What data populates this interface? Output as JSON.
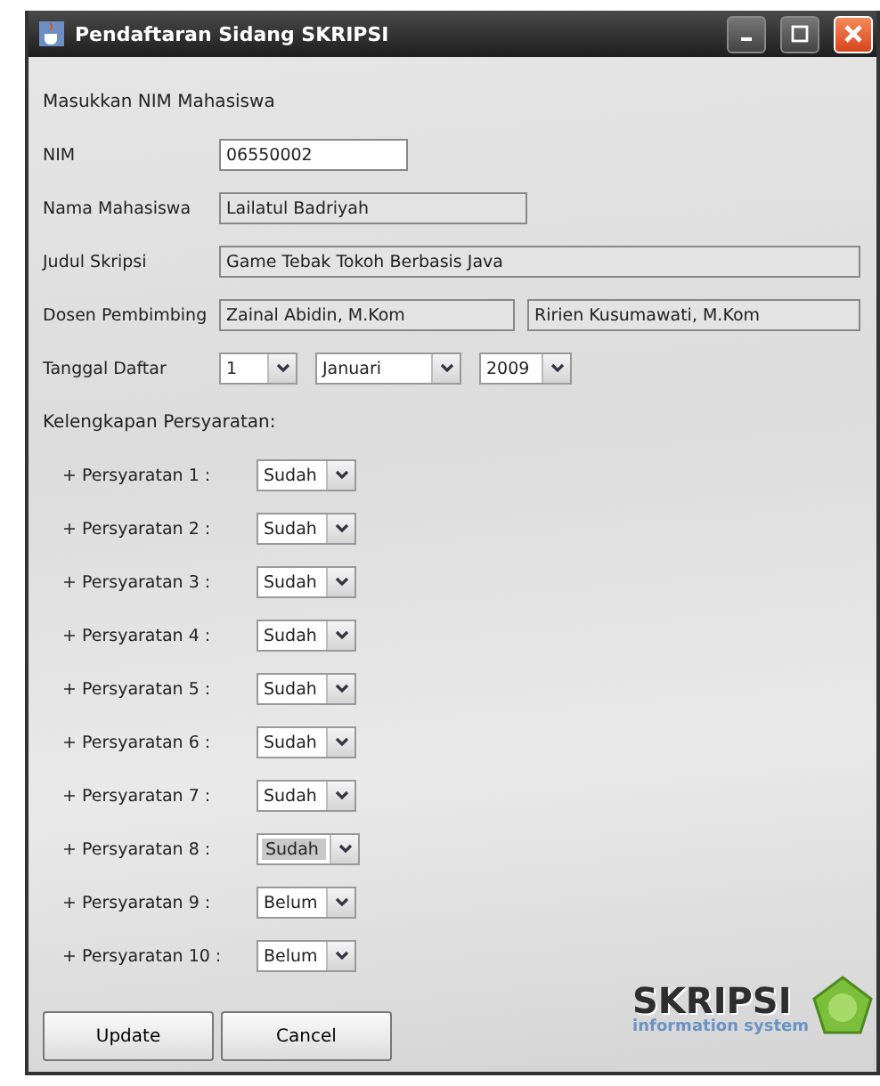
{
  "window": {
    "title": "Pendaftaran Sidang SKRIPSI"
  },
  "heading": "Masukkan NIM Mahasiswa",
  "fields": [
    {
      "label": "NIM",
      "value": "06550002",
      "editable": true
    },
    {
      "label": "Nama Mahasiswa",
      "value": "Lailatul Badriyah",
      "editable": false
    },
    {
      "label": "Judul Skripsi",
      "value": "Game Tebak Tokoh Berbasis Java",
      "editable": false
    }
  ],
  "supervisors": {
    "label": "Dosen Pembimbing",
    "values": [
      "Zainal Abidin, M.Kom",
      "Ririen Kusumawati, M.Kom"
    ]
  },
  "date": {
    "label": "Tanggal Daftar",
    "day": "1",
    "month": "Januari",
    "year": "2009"
  },
  "requirements_heading": "Kelengkapan Persyaratan:",
  "requirements": [
    {
      "label": "+ Persyaratan 1 :",
      "value": "Sudah",
      "focused": false
    },
    {
      "label": "+ Persyaratan 2 :",
      "value": "Sudah",
      "focused": false
    },
    {
      "label": "+ Persyaratan 3 :",
      "value": "Sudah",
      "focused": false
    },
    {
      "label": "+ Persyaratan 4 :",
      "value": "Sudah",
      "focused": false
    },
    {
      "label": "+ Persyaratan 5 :",
      "value": "Sudah",
      "focused": false
    },
    {
      "label": "+ Persyaratan 6 :",
      "value": "Sudah",
      "focused": false
    },
    {
      "label": "+ Persyaratan 7 :",
      "value": "Sudah",
      "focused": false
    },
    {
      "label": "+ Persyaratan 8 :",
      "value": "Sudah",
      "focused": true
    },
    {
      "label": "+ Persyaratan 9 :",
      "value": "Belum",
      "focused": false
    },
    {
      "label": "+ Persyaratan 10 :",
      "value": "Belum",
      "focused": false
    }
  ],
  "buttons": [
    "Update",
    "Cancel"
  ],
  "logo": {
    "name": "SKRIPSI",
    "tagline": "information system"
  }
}
